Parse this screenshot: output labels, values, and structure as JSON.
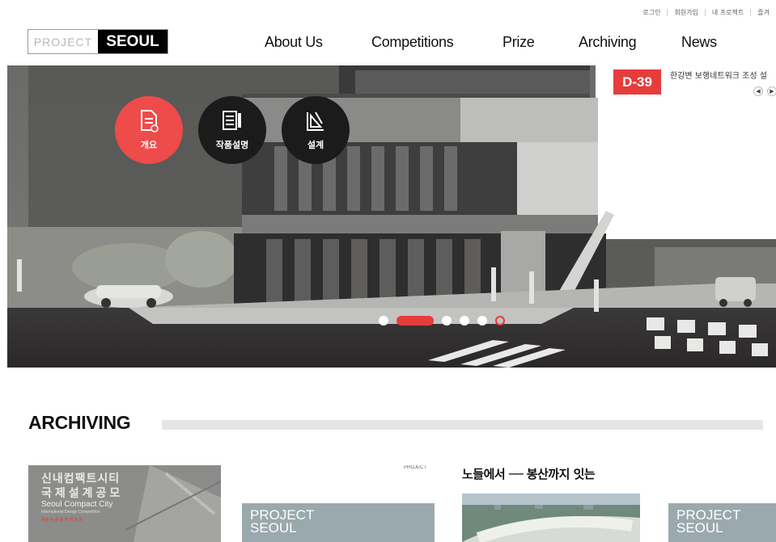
{
  "utility_links": [
    "로그인",
    "회원가입",
    "내 프로젝트",
    "즐겨"
  ],
  "logo": {
    "left": "PROJECT",
    "right": "SEOUL"
  },
  "nav": [
    "About Us",
    "Competitions",
    "Prize",
    "Archiving",
    "News"
  ],
  "hero": {
    "circles": [
      {
        "label": "개요",
        "icon": "document-icon",
        "color": "#ee4b4b"
      },
      {
        "label": "작품설명",
        "icon": "sheets-icon",
        "color": "#1b1b1b"
      },
      {
        "label": "설계",
        "icon": "drafting-icon",
        "color": "#1b1b1b"
      }
    ],
    "dday": "D-39",
    "competition_title": "한강변 보행네트워크 조성 설",
    "controls": [
      "◀",
      "▶"
    ]
  },
  "archiving": {
    "title": "ARCHIVING",
    "cards": [
      {
        "line1": "신내컴팩트시티",
        "line2": "국제설계공모",
        "line3": "Seoul Compact City",
        "line4": "International Design Competition",
        "line5": "제출 작 품 설 명 회 일 정"
      },
      {
        "band1": "PROJECT",
        "band2": "SEOUL",
        "small": "PROJECT"
      },
      {
        "title": "노들에서 ── 봉산까지 잇는"
      },
      {
        "band1": "PROJECT",
        "band2": "SEOUL"
      }
    ]
  },
  "colors": {
    "accent": "#e63c3c",
    "dark": "#1b1b1b",
    "card_band": "#9aa9ae"
  }
}
